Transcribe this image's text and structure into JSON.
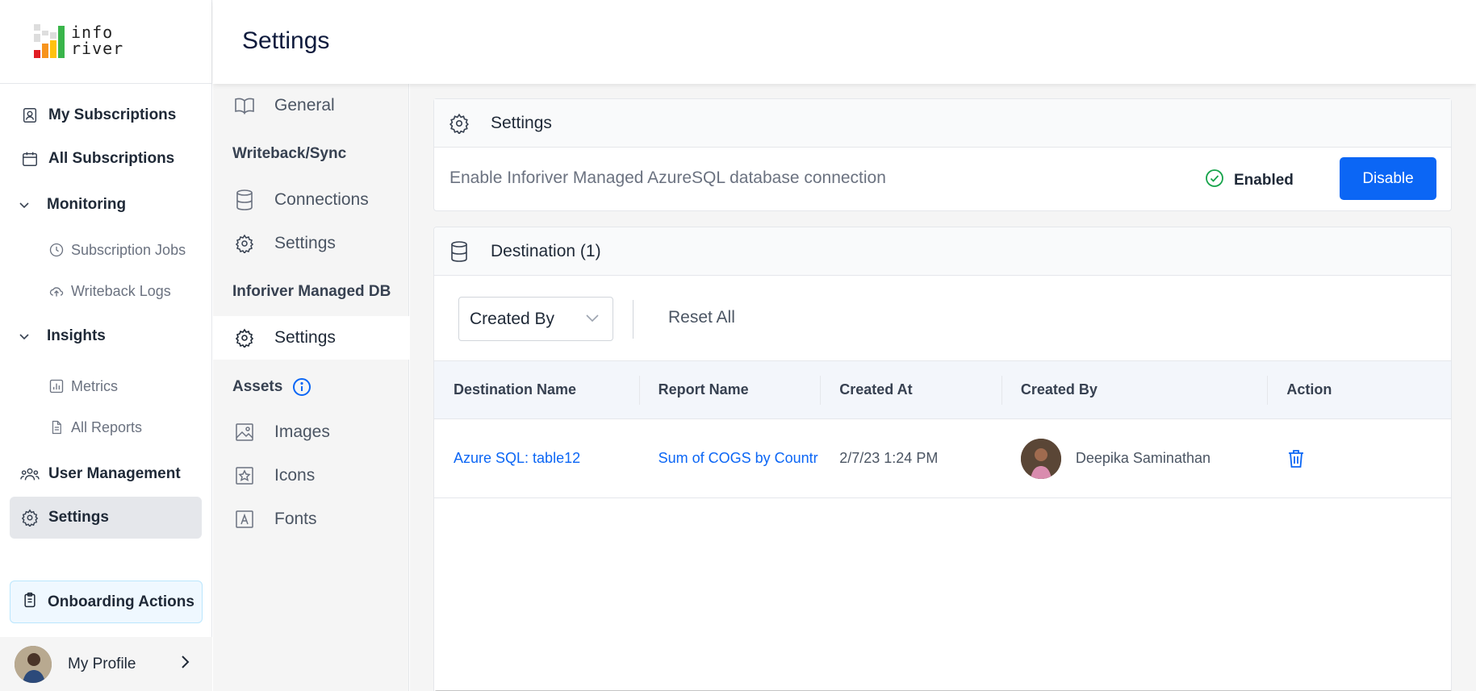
{
  "brand": {
    "logo_line1": "info",
    "logo_line2": "river"
  },
  "leftnav": {
    "my_subscriptions": "My Subscriptions",
    "all_subscriptions": "All Subscriptions",
    "monitoring": "Monitoring",
    "subscription_jobs": "Subscription Jobs",
    "writeback_logs": "Writeback Logs",
    "insights": "Insights",
    "metrics": "Metrics",
    "all_reports": "All Reports",
    "user_management": "User Management",
    "settings": "Settings",
    "onboarding_actions": "Onboarding Actions",
    "my_profile": "My Profile"
  },
  "header": {
    "title": "Settings"
  },
  "subnav": {
    "general": "General",
    "writeback_heading": "Writeback/Sync",
    "connections": "Connections",
    "wb_settings": "Settings",
    "managed_db_heading": "Inforiver Managed DB",
    "db_settings": "Settings",
    "assets_heading": "Assets",
    "images": "Images",
    "icons": "Icons",
    "fonts": "Fonts"
  },
  "settings_card": {
    "title": "Settings",
    "enable_text": "Enable Inforiver Managed AzureSQL database connection",
    "status": "Enabled",
    "action_button": "Disable"
  },
  "destination_card": {
    "title": "Destination (1)",
    "filter_select": "Created By",
    "reset_label": "Reset All",
    "columns": [
      "Destination Name",
      "Report Name",
      "Created At",
      "Created By",
      "Action"
    ],
    "rows": [
      {
        "destination": "Azure SQL: table12",
        "report": "Sum of COGS by Countr",
        "created_at": "2/7/23 1:24 PM",
        "created_by": "Deepika Saminathan"
      }
    ]
  },
  "colors": {
    "accent": "#0b66f5",
    "success": "#16a34a",
    "nav_active": "#e5e7eb"
  }
}
